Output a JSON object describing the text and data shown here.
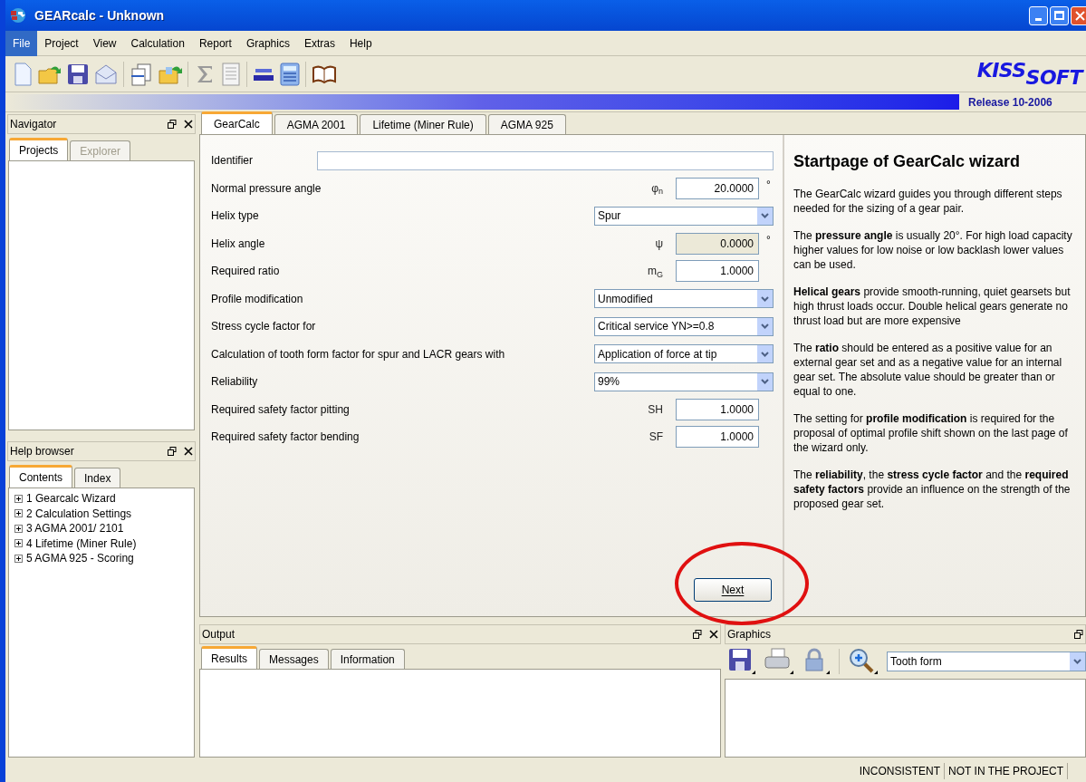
{
  "window": {
    "title": "GEARcalc - Unknown"
  },
  "menu": [
    {
      "label": "File",
      "selected": true
    },
    {
      "label": "Project",
      "selected": false
    },
    {
      "label": "View",
      "selected": false
    },
    {
      "label": "Calculation",
      "selected": false
    },
    {
      "label": "Report",
      "selected": false
    },
    {
      "label": "Graphics",
      "selected": false
    },
    {
      "label": "Extras",
      "selected": false
    },
    {
      "label": "Help",
      "selected": false
    }
  ],
  "brand": {
    "logo_top": "KISS",
    "logo_bottom": "SOFT",
    "release": "Release 10-2006"
  },
  "navigator": {
    "title": "Navigator",
    "tabs": [
      {
        "label": "Projects",
        "selected": true,
        "disabled": false
      },
      {
        "label": "Explorer",
        "selected": false,
        "disabled": true
      }
    ]
  },
  "help_browser": {
    "title": "Help browser",
    "tabs": [
      {
        "label": "Contents",
        "selected": true
      },
      {
        "label": "Index",
        "selected": false
      }
    ],
    "tree": [
      {
        "label": "1 Gearcalc Wizard",
        "expanded": false
      },
      {
        "label": "2 Calculation Settings",
        "expanded": false
      },
      {
        "label": "3 AGMA 2001/ 2101",
        "expanded": false
      },
      {
        "label": "4 Lifetime (Miner Rule)",
        "expanded": false
      },
      {
        "label": "5 AGMA 925 - Scoring",
        "expanded": false
      }
    ]
  },
  "main_tabs": [
    {
      "label": "GearCalc",
      "selected": true
    },
    {
      "label": "AGMA 2001",
      "selected": false
    },
    {
      "label": "Lifetime (Miner Rule)",
      "selected": false
    },
    {
      "label": "AGMA 925",
      "selected": false
    }
  ],
  "form": [
    {
      "kind": "text",
      "label": "Identifier"
    },
    {
      "kind": "number",
      "label": "Normal pressure angle",
      "symbol": "φ$_{n}$",
      "value": "20.0000",
      "unit": "°",
      "disabled": false
    },
    {
      "kind": "select",
      "label": "Helix type",
      "value": "Spur"
    },
    {
      "kind": "number",
      "label": "Helix angle",
      "symbol": "ψ",
      "value": "0.0000",
      "unit": "°",
      "disabled": true
    },
    {
      "kind": "number",
      "label": "Required ratio",
      "symbol": "m$_{G}$",
      "value": "1.0000",
      "disabled": false
    },
    {
      "kind": "select",
      "label": "Profile modification",
      "value": "Unmodified"
    },
    {
      "kind": "select",
      "label": "Stress cycle factor for",
      "value": "Critical service YN>=0.8"
    },
    {
      "kind": "select",
      "label": "Calculation of tooth form factor for spur and LACR gears with",
      "value": "Application of force at tip"
    },
    {
      "kind": "select",
      "label": "Reliability",
      "value": "99%"
    },
    {
      "kind": "number",
      "label": "Required safety factor pitting",
      "symbol": "SH",
      "value": "1.0000",
      "disabled": false
    },
    {
      "kind": "number",
      "label": "Required safety factor bending",
      "symbol": "SF",
      "value": "1.0000",
      "disabled": false
    }
  ],
  "next_button": "Next",
  "help_panel": {
    "title": "Startpage of GearCalc wizard",
    "paragraphs": [
      "The GearCalc wizard guides you through different steps needed for the sizing of a gear pair.",
      "The **pressure angle** is usually 20°. For high load capacity higher values for low noise or low backlash lower values can be used.",
      "**Helical gears** provide smooth-running, quiet gearsets but high thrust loads occur. Double helical gears generate no thrust load but are more expensive",
      "The **ratio** should be entered as a positive value for an external gear set and as a negative value for an internal gear set. The absolute value should be greater than or equal to one.",
      "The setting for **profile modification** is required for the proposal of optimal profile shift shown on the last page of the wizard only.",
      "The **reliability**, the **stress cycle factor** and the **required safety factors** provide an influence on the strength of the proposed gear set."
    ]
  },
  "output": {
    "title": "Output",
    "tabs": [
      {
        "label": "Results",
        "selected": true
      },
      {
        "label": "Messages",
        "selected": false
      },
      {
        "label": "Information",
        "selected": false
      }
    ]
  },
  "graphics": {
    "title": "Graphics",
    "view": "Tooth form"
  },
  "status_bar": [
    "INCONSISTENT",
    "NOT IN THE PROJECT"
  ]
}
